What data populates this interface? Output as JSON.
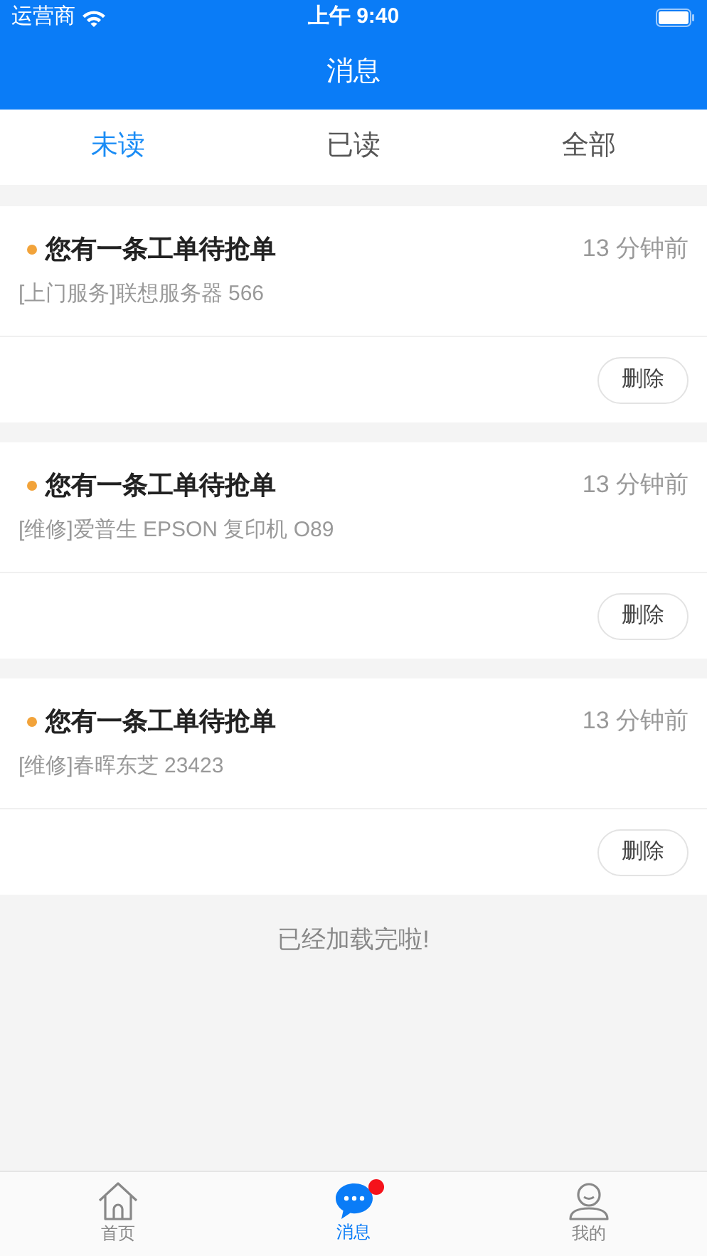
{
  "status_bar": {
    "carrier": "运营商",
    "time": "上午 9:40"
  },
  "nav": {
    "title": "消息"
  },
  "tabs": [
    {
      "label": "未读",
      "selected": true
    },
    {
      "label": "已读",
      "selected": false
    },
    {
      "label": "全部",
      "selected": false
    }
  ],
  "messages": [
    {
      "title": "您有一条工单待抢单",
      "unread": true,
      "time": "13 分钟前",
      "detail": "[上门服务]联想服务器 566",
      "action": "删除"
    },
    {
      "title": "您有一条工单待抢单",
      "unread": true,
      "time": "13 分钟前",
      "detail": "[维修]爱普生 EPSON 复印机 O89",
      "action": "删除"
    },
    {
      "title": "您有一条工单待抢单",
      "unread": true,
      "time": "13 分钟前",
      "detail": "[维修]春晖东芝 23423",
      "action": "删除"
    }
  ],
  "footer_note": "已经加载完啦!",
  "tab_bar": [
    {
      "kind": "home",
      "label": "首页",
      "selected": false,
      "badge": false
    },
    {
      "kind": "chat",
      "label": "消息",
      "selected": true,
      "badge": true
    },
    {
      "kind": "user",
      "label": "我的",
      "selected": false,
      "badge": false
    }
  ]
}
